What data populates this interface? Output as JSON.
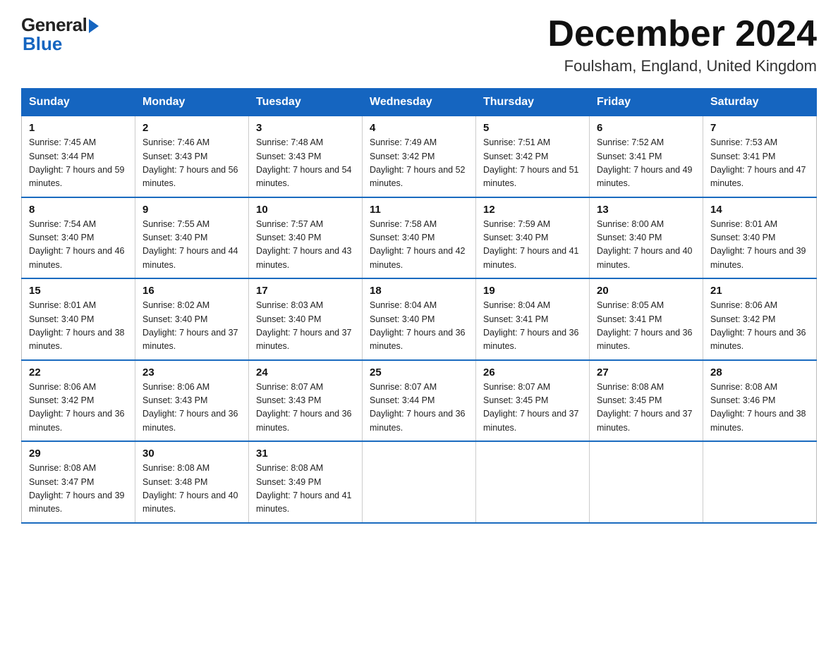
{
  "header": {
    "logo_general": "General",
    "logo_blue": "Blue",
    "month_title": "December 2024",
    "location": "Foulsham, England, United Kingdom"
  },
  "days_of_week": [
    "Sunday",
    "Monday",
    "Tuesday",
    "Wednesday",
    "Thursday",
    "Friday",
    "Saturday"
  ],
  "weeks": [
    [
      {
        "day": "1",
        "sunrise": "7:45 AM",
        "sunset": "3:44 PM",
        "daylight": "7 hours and 59 minutes."
      },
      {
        "day": "2",
        "sunrise": "7:46 AM",
        "sunset": "3:43 PM",
        "daylight": "7 hours and 56 minutes."
      },
      {
        "day": "3",
        "sunrise": "7:48 AM",
        "sunset": "3:43 PM",
        "daylight": "7 hours and 54 minutes."
      },
      {
        "day": "4",
        "sunrise": "7:49 AM",
        "sunset": "3:42 PM",
        "daylight": "7 hours and 52 minutes."
      },
      {
        "day": "5",
        "sunrise": "7:51 AM",
        "sunset": "3:42 PM",
        "daylight": "7 hours and 51 minutes."
      },
      {
        "day": "6",
        "sunrise": "7:52 AM",
        "sunset": "3:41 PM",
        "daylight": "7 hours and 49 minutes."
      },
      {
        "day": "7",
        "sunrise": "7:53 AM",
        "sunset": "3:41 PM",
        "daylight": "7 hours and 47 minutes."
      }
    ],
    [
      {
        "day": "8",
        "sunrise": "7:54 AM",
        "sunset": "3:40 PM",
        "daylight": "7 hours and 46 minutes."
      },
      {
        "day": "9",
        "sunrise": "7:55 AM",
        "sunset": "3:40 PM",
        "daylight": "7 hours and 44 minutes."
      },
      {
        "day": "10",
        "sunrise": "7:57 AM",
        "sunset": "3:40 PM",
        "daylight": "7 hours and 43 minutes."
      },
      {
        "day": "11",
        "sunrise": "7:58 AM",
        "sunset": "3:40 PM",
        "daylight": "7 hours and 42 minutes."
      },
      {
        "day": "12",
        "sunrise": "7:59 AM",
        "sunset": "3:40 PM",
        "daylight": "7 hours and 41 minutes."
      },
      {
        "day": "13",
        "sunrise": "8:00 AM",
        "sunset": "3:40 PM",
        "daylight": "7 hours and 40 minutes."
      },
      {
        "day": "14",
        "sunrise": "8:01 AM",
        "sunset": "3:40 PM",
        "daylight": "7 hours and 39 minutes."
      }
    ],
    [
      {
        "day": "15",
        "sunrise": "8:01 AM",
        "sunset": "3:40 PM",
        "daylight": "7 hours and 38 minutes."
      },
      {
        "day": "16",
        "sunrise": "8:02 AM",
        "sunset": "3:40 PM",
        "daylight": "7 hours and 37 minutes."
      },
      {
        "day": "17",
        "sunrise": "8:03 AM",
        "sunset": "3:40 PM",
        "daylight": "7 hours and 37 minutes."
      },
      {
        "day": "18",
        "sunrise": "8:04 AM",
        "sunset": "3:40 PM",
        "daylight": "7 hours and 36 minutes."
      },
      {
        "day": "19",
        "sunrise": "8:04 AM",
        "sunset": "3:41 PM",
        "daylight": "7 hours and 36 minutes."
      },
      {
        "day": "20",
        "sunrise": "8:05 AM",
        "sunset": "3:41 PM",
        "daylight": "7 hours and 36 minutes."
      },
      {
        "day": "21",
        "sunrise": "8:06 AM",
        "sunset": "3:42 PM",
        "daylight": "7 hours and 36 minutes."
      }
    ],
    [
      {
        "day": "22",
        "sunrise": "8:06 AM",
        "sunset": "3:42 PM",
        "daylight": "7 hours and 36 minutes."
      },
      {
        "day": "23",
        "sunrise": "8:06 AM",
        "sunset": "3:43 PM",
        "daylight": "7 hours and 36 minutes."
      },
      {
        "day": "24",
        "sunrise": "8:07 AM",
        "sunset": "3:43 PM",
        "daylight": "7 hours and 36 minutes."
      },
      {
        "day": "25",
        "sunrise": "8:07 AM",
        "sunset": "3:44 PM",
        "daylight": "7 hours and 36 minutes."
      },
      {
        "day": "26",
        "sunrise": "8:07 AM",
        "sunset": "3:45 PM",
        "daylight": "7 hours and 37 minutes."
      },
      {
        "day": "27",
        "sunrise": "8:08 AM",
        "sunset": "3:45 PM",
        "daylight": "7 hours and 37 minutes."
      },
      {
        "day": "28",
        "sunrise": "8:08 AM",
        "sunset": "3:46 PM",
        "daylight": "7 hours and 38 minutes."
      }
    ],
    [
      {
        "day": "29",
        "sunrise": "8:08 AM",
        "sunset": "3:47 PM",
        "daylight": "7 hours and 39 minutes."
      },
      {
        "day": "30",
        "sunrise": "8:08 AM",
        "sunset": "3:48 PM",
        "daylight": "7 hours and 40 minutes."
      },
      {
        "day": "31",
        "sunrise": "8:08 AM",
        "sunset": "3:49 PM",
        "daylight": "7 hours and 41 minutes."
      },
      null,
      null,
      null,
      null
    ]
  ]
}
